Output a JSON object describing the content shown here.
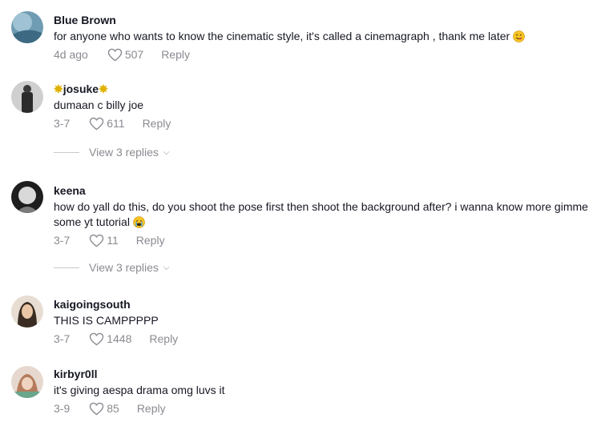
{
  "comments": [
    {
      "username": "Blue Brown",
      "text": "for anyone who wants to know the cinematic style, it's called a cinemagraph , thank me later",
      "emoji": "yum-emoji",
      "date": "4d ago",
      "likes": "507",
      "reply_label": "Reply"
    },
    {
      "username_prefix": "✸",
      "username": "josuke",
      "username_suffix": "✸",
      "text": "dumaan c billy joe",
      "date": "3-7",
      "likes": "611",
      "reply_label": "Reply",
      "view_replies": "View 3 replies"
    },
    {
      "username": "keena",
      "text": "how do yall do this, do you shoot the pose first then shoot the background after? i wanna know more gimme some yt tutorial",
      "emoji": "crying-emoji",
      "date": "3-7",
      "likes": "11",
      "reply_label": "Reply",
      "view_replies": "View 3 replies"
    },
    {
      "username": "kaigoingsouth",
      "text": "THIS IS CAMPPPPP",
      "date": "3-7",
      "likes": "1448",
      "reply_label": "Reply"
    },
    {
      "username": "kirbyr0ll",
      "text": "it's giving aespa drama omg luvs it",
      "date": "3-9",
      "likes": "85",
      "reply_label": "Reply"
    }
  ],
  "colors": {
    "text": "#161823",
    "muted": "#8a8b91"
  }
}
